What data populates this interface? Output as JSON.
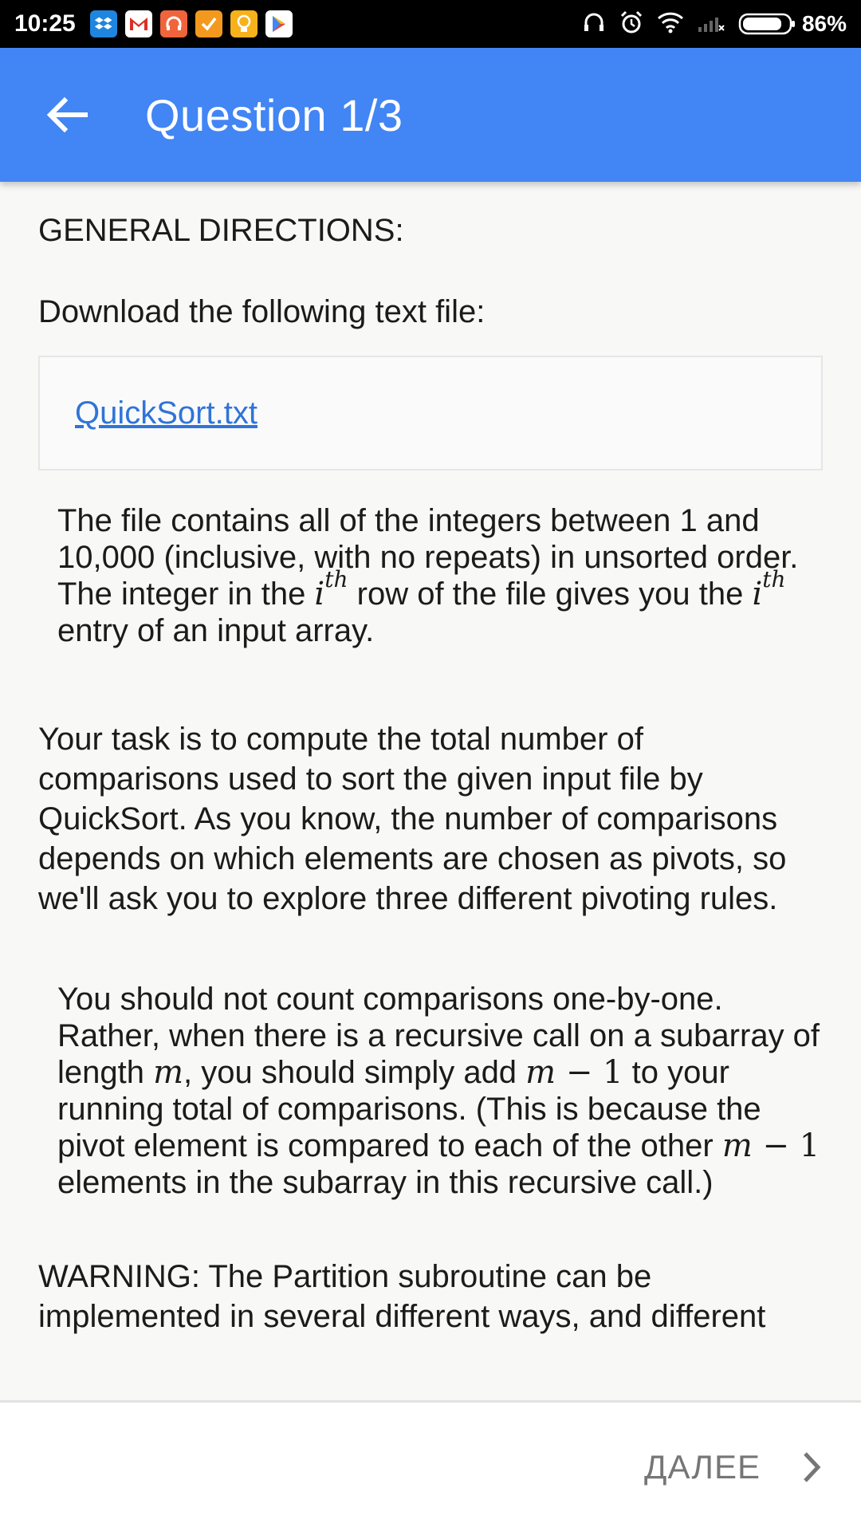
{
  "status_bar": {
    "time": "10:25",
    "battery": "86%",
    "notification_icons": [
      "dropbox-icon",
      "gmail-icon",
      "headphones-app-icon",
      "todo-app-icon",
      "lightbulb-app-icon",
      "play-store-icon"
    ]
  },
  "app_bar": {
    "title": "Question 1/3"
  },
  "content": {
    "heading": "GENERAL DIRECTIONS:",
    "download_intro": "Download the following text file:",
    "file_link": "QuickSort.txt",
    "file_description": {
      "part1": "The file contains all of the integers between 1 and 10,000 (inclusive, with no repeats) in unsorted order. The integer in the ",
      "part2": " row of the file gives you the ",
      "part3": " entry of an input array.",
      "math_i": "i",
      "math_th": "th"
    },
    "task_paragraph": "Your task is to compute the total number of comparisons used to sort the given input file by QuickSort. As you know, the number of comparisons depends on which elements are chosen as pivots, so we'll ask you to explore three different pivoting rules.",
    "counting_note": {
      "part1": "You should not count comparisons one-by-one. Rather, when there is a recursive call on a subarray of length ",
      "part2": ", you should simply add ",
      "part3": " to your running total of comparisons. (This is because the pivot element is compared to each of the other ",
      "part4": " elements in the subarray in this recursive call.)",
      "math_m": "m",
      "math_m_minus_1_var": "m",
      "math_m_minus_1_rest": " − 1"
    },
    "warning_paragraph": "WARNING: The Partition subroutine can be implemented in several different ways, and different"
  },
  "bottom_bar": {
    "next_label": "ДАЛЕЕ"
  },
  "colors": {
    "app_bar": "#4285f4",
    "link": "#2f74d8",
    "next_label": "#767676",
    "background": "#f8f8f7"
  }
}
